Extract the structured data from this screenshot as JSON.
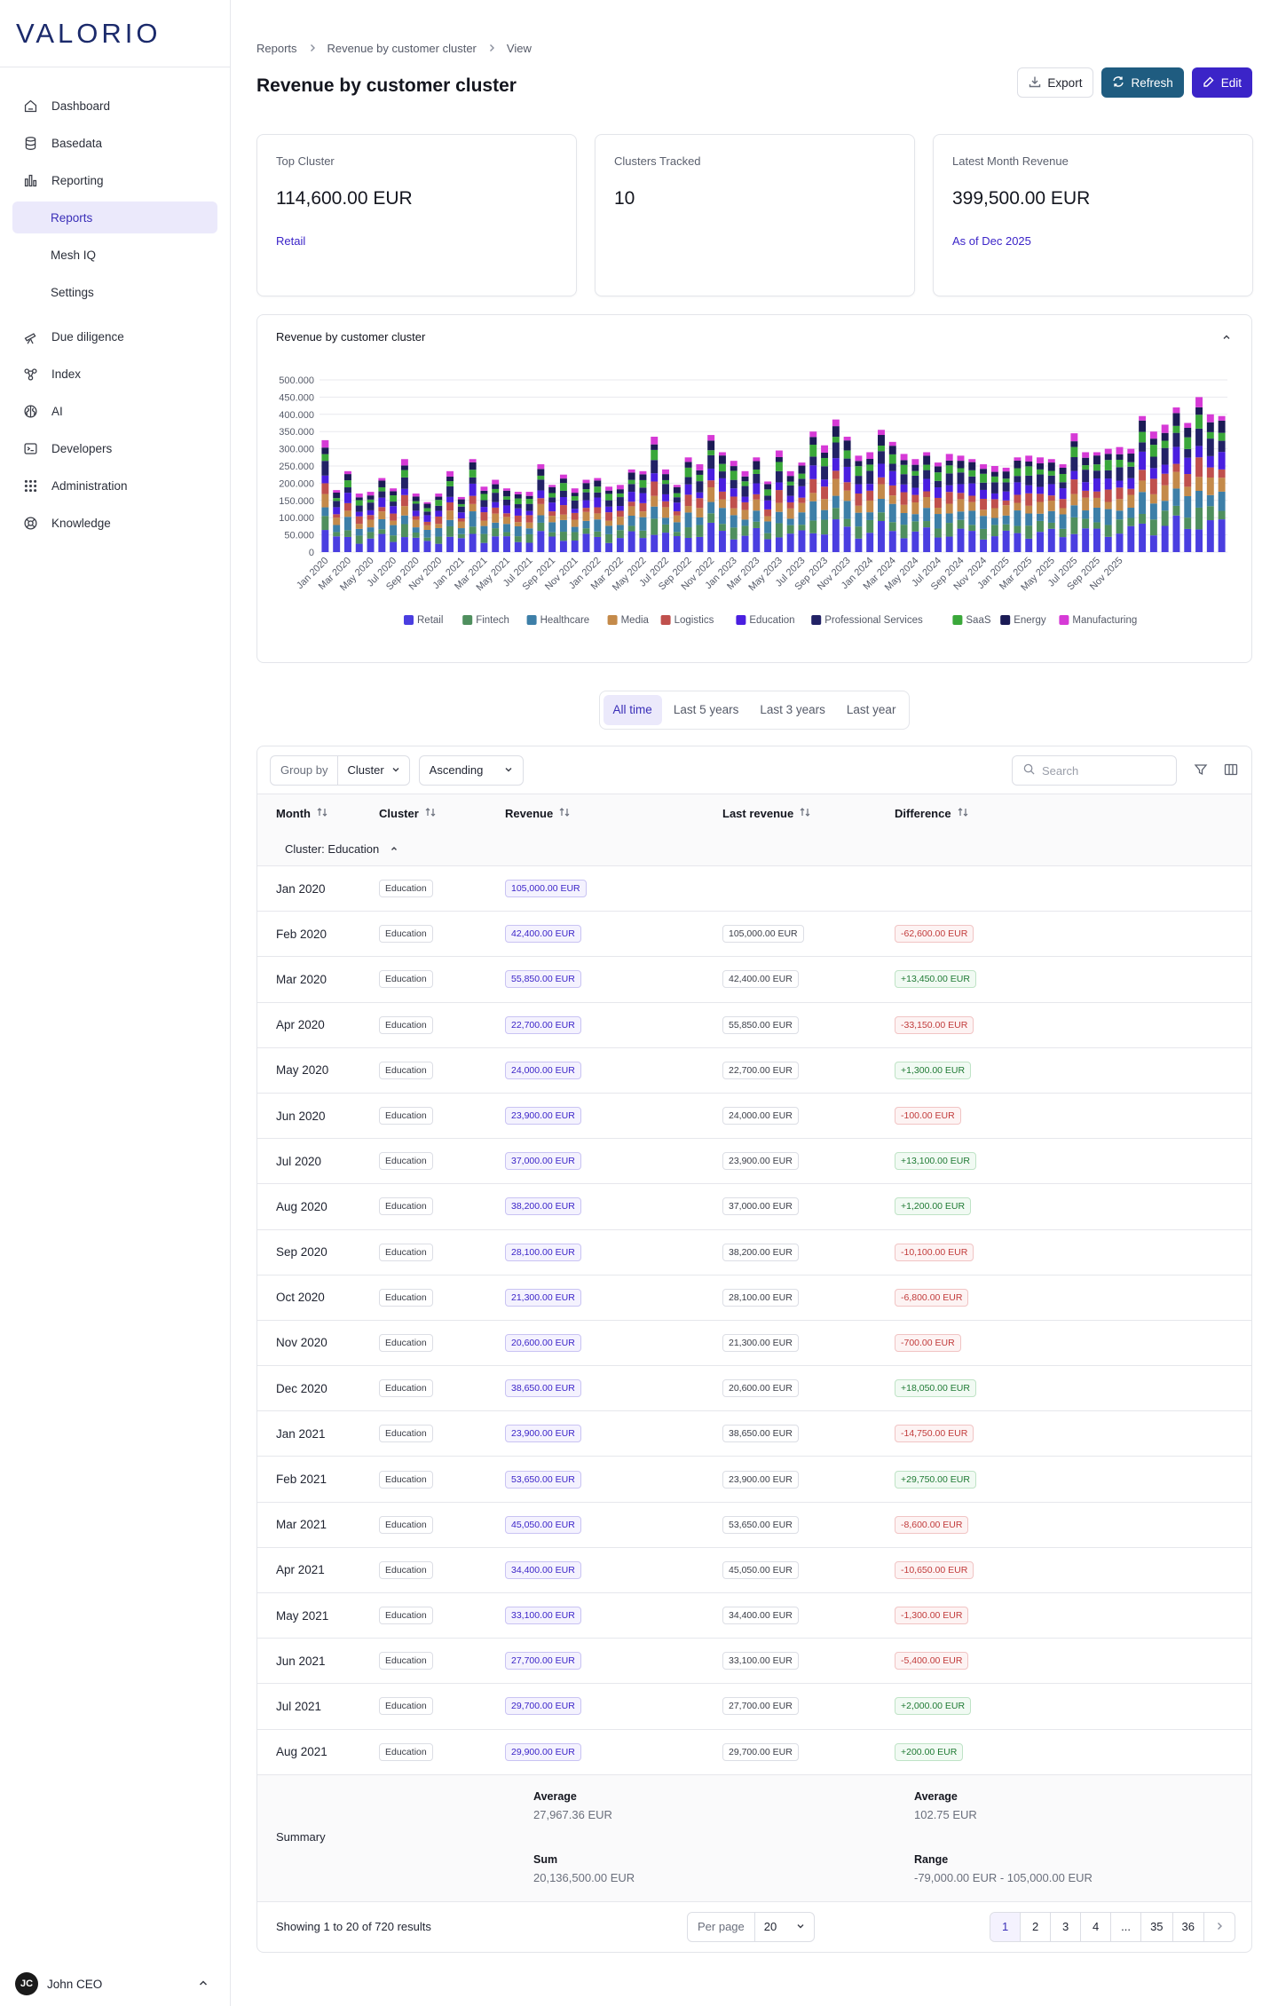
{
  "brand": "VALORIO",
  "nav": {
    "items": [
      {
        "label": "Dashboard",
        "icon": "home-icon"
      },
      {
        "label": "Basedata",
        "icon": "database-icon"
      },
      {
        "label": "Reporting",
        "icon": "bar-chart-icon"
      },
      {
        "label": "Reports",
        "icon": ""
      },
      {
        "label": "Mesh IQ",
        "icon": ""
      },
      {
        "label": "Settings",
        "icon": ""
      },
      {
        "label": "Due diligence",
        "icon": "telescope-icon"
      },
      {
        "label": "Index",
        "icon": "network-icon"
      },
      {
        "label": "AI",
        "icon": "brain-icon"
      },
      {
        "label": "Developers",
        "icon": "terminal-icon"
      },
      {
        "label": "Administration",
        "icon": "grid-icon"
      },
      {
        "label": "Knowledge",
        "icon": "lifebuoy-icon"
      }
    ]
  },
  "user": {
    "initials": "JC",
    "name": "John CEO"
  },
  "breadcrumb": [
    "Reports",
    "Revenue by customer cluster",
    "View"
  ],
  "page_title": "Revenue by customer cluster",
  "actions": {
    "export": "Export",
    "refresh": "Refresh",
    "edit": "Edit"
  },
  "cards": [
    {
      "label": "Top Cluster",
      "value": "114,600.00 EUR",
      "sub": "Retail"
    },
    {
      "label": "Clusters Tracked",
      "value": "10",
      "sub": ""
    },
    {
      "label": "Latest Month Revenue",
      "value": "399,500.00 EUR",
      "sub": "As of Dec 2025"
    }
  ],
  "chart_panel_title": "Revenue by customer cluster",
  "chart_data": {
    "type": "bar",
    "stacked": true,
    "ylim": [
      0,
      500000
    ],
    "yticks": [
      "0",
      "50.000",
      "100.000",
      "150.000",
      "200.000",
      "250.000",
      "300.000",
      "350.000",
      "400.000",
      "450.000",
      "500.000"
    ],
    "xtick_labels": [
      "Jan 2020",
      "Mar 2020",
      "May 2020",
      "Jul 2020",
      "Sep 2020",
      "Nov 2020",
      "Jan 2021",
      "Mar 2021",
      "May 2021",
      "Jul 2021",
      "Sep 2021",
      "Nov 2021",
      "Jan 2022",
      "Mar 2022",
      "May 2022",
      "Jul 2022",
      "Sep 2022",
      "Nov 2022",
      "Jan 2023",
      "Mar 2023",
      "May 2023",
      "Jul 2023",
      "Sep 2023",
      "Nov 2023",
      "Jan 2024",
      "Mar 2024",
      "May 2024",
      "Jul 2024",
      "Sep 2024",
      "Nov 2024",
      "Jan 2025",
      "Mar 2025",
      "May 2025",
      "Jul 2025",
      "Sep 2025",
      "Nov 2025"
    ],
    "totals": [
      325000,
      180000,
      235000,
      170000,
      175000,
      215000,
      185000,
      270000,
      170000,
      145000,
      170000,
      235000,
      160000,
      270000,
      190000,
      210000,
      185000,
      175000,
      175000,
      255000,
      195000,
      225000,
      185000,
      210000,
      215000,
      190000,
      195000,
      240000,
      235000,
      335000,
      240000,
      195000,
      275000,
      255000,
      340000,
      290000,
      265000,
      235000,
      275000,
      205000,
      295000,
      235000,
      260000,
      350000,
      310000,
      385000,
      335000,
      280000,
      290000,
      355000,
      320000,
      285000,
      270000,
      290000,
      260000,
      285000,
      280000,
      270000,
      255000,
      250000,
      245000,
      275000,
      280000,
      275000,
      270000,
      255000,
      345000,
      290000,
      290000,
      300000,
      305000,
      300000,
      395000,
      350000,
      370000,
      420000,
      375000,
      450000,
      400000,
      395000
    ],
    "series": [
      {
        "name": "Retail",
        "color": "#4a3ee0",
        "share": 0.2
      },
      {
        "name": "Fintech",
        "color": "#4f8f5e",
        "share": 0.1
      },
      {
        "name": "Healthcare",
        "color": "#3d7fa8",
        "share": 0.12
      },
      {
        "name": "Media",
        "color": "#c48a4a",
        "share": 0.1
      },
      {
        "name": "Logistics",
        "color": "#c0504d",
        "share": 0.09
      },
      {
        "name": "Education",
        "color": "#4a1fe0",
        "share": 0.1
      },
      {
        "name": "Professional Services",
        "color": "#222266",
        "share": 0.1
      },
      {
        "name": "SaaS",
        "color": "#3aa83a",
        "share": 0.07
      },
      {
        "name": "Energy",
        "color": "#1b1b55",
        "share": 0.07
      },
      {
        "name": "Manufacturing",
        "color": "#d63ad6",
        "share": 0.05
      }
    ]
  },
  "range_tabs": [
    "All time",
    "Last 5 years",
    "Last 3 years",
    "Last year"
  ],
  "toolbar": {
    "group_by_label": "Group by",
    "group_by_value": "Cluster",
    "sort_value": "Ascending",
    "search_placeholder": "Search"
  },
  "table": {
    "columns": [
      "Month",
      "Cluster",
      "Revenue",
      "Last revenue",
      "Difference"
    ],
    "group_label": "Cluster: Education",
    "rows": [
      {
        "month": "Jan 2020",
        "cluster": "Education",
        "revenue": "105,000.00 EUR",
        "last": "",
        "diff": "",
        "sign": ""
      },
      {
        "month": "Feb 2020",
        "cluster": "Education",
        "revenue": "42,400.00 EUR",
        "last": "105,000.00 EUR",
        "diff": "-62,600.00 EUR",
        "sign": "neg"
      },
      {
        "month": "Mar 2020",
        "cluster": "Education",
        "revenue": "55,850.00 EUR",
        "last": "42,400.00 EUR",
        "diff": "+13,450.00 EUR",
        "sign": "pos"
      },
      {
        "month": "Apr 2020",
        "cluster": "Education",
        "revenue": "22,700.00 EUR",
        "last": "55,850.00 EUR",
        "diff": "-33,150.00 EUR",
        "sign": "neg"
      },
      {
        "month": "May 2020",
        "cluster": "Education",
        "revenue": "24,000.00 EUR",
        "last": "22,700.00 EUR",
        "diff": "+1,300.00 EUR",
        "sign": "pos"
      },
      {
        "month": "Jun 2020",
        "cluster": "Education",
        "revenue": "23,900.00 EUR",
        "last": "24,000.00 EUR",
        "diff": "-100.00 EUR",
        "sign": "neg"
      },
      {
        "month": "Jul 2020",
        "cluster": "Education",
        "revenue": "37,000.00 EUR",
        "last": "23,900.00 EUR",
        "diff": "+13,100.00 EUR",
        "sign": "pos"
      },
      {
        "month": "Aug 2020",
        "cluster": "Education",
        "revenue": "38,200.00 EUR",
        "last": "37,000.00 EUR",
        "diff": "+1,200.00 EUR",
        "sign": "pos"
      },
      {
        "month": "Sep 2020",
        "cluster": "Education",
        "revenue": "28,100.00 EUR",
        "last": "38,200.00 EUR",
        "diff": "-10,100.00 EUR",
        "sign": "neg"
      },
      {
        "month": "Oct 2020",
        "cluster": "Education",
        "revenue": "21,300.00 EUR",
        "last": "28,100.00 EUR",
        "diff": "-6,800.00 EUR",
        "sign": "neg"
      },
      {
        "month": "Nov 2020",
        "cluster": "Education",
        "revenue": "20,600.00 EUR",
        "last": "21,300.00 EUR",
        "diff": "-700.00 EUR",
        "sign": "neg"
      },
      {
        "month": "Dec 2020",
        "cluster": "Education",
        "revenue": "38,650.00 EUR",
        "last": "20,600.00 EUR",
        "diff": "+18,050.00 EUR",
        "sign": "pos"
      },
      {
        "month": "Jan 2021",
        "cluster": "Education",
        "revenue": "23,900.00 EUR",
        "last": "38,650.00 EUR",
        "diff": "-14,750.00 EUR",
        "sign": "neg"
      },
      {
        "month": "Feb 2021",
        "cluster": "Education",
        "revenue": "53,650.00 EUR",
        "last": "23,900.00 EUR",
        "diff": "+29,750.00 EUR",
        "sign": "pos"
      },
      {
        "month": "Mar 2021",
        "cluster": "Education",
        "revenue": "45,050.00 EUR",
        "last": "53,650.00 EUR",
        "diff": "-8,600.00 EUR",
        "sign": "neg"
      },
      {
        "month": "Apr 2021",
        "cluster": "Education",
        "revenue": "34,400.00 EUR",
        "last": "45,050.00 EUR",
        "diff": "-10,650.00 EUR",
        "sign": "neg"
      },
      {
        "month": "May 2021",
        "cluster": "Education",
        "revenue": "33,100.00 EUR",
        "last": "34,400.00 EUR",
        "diff": "-1,300.00 EUR",
        "sign": "neg"
      },
      {
        "month": "Jun 2021",
        "cluster": "Education",
        "revenue": "27,700.00 EUR",
        "last": "33,100.00 EUR",
        "diff": "-5,400.00 EUR",
        "sign": "neg"
      },
      {
        "month": "Jul 2021",
        "cluster": "Education",
        "revenue": "29,700.00 EUR",
        "last": "27,700.00 EUR",
        "diff": "+2,000.00 EUR",
        "sign": "pos"
      },
      {
        "month": "Aug 2021",
        "cluster": "Education",
        "revenue": "29,900.00 EUR",
        "last": "29,700.00 EUR",
        "diff": "+200.00 EUR",
        "sign": "pos"
      }
    ]
  },
  "summary": {
    "label": "Summary",
    "avg_rev_label": "Average",
    "avg_rev": "27,967.36 EUR",
    "sum_label": "Sum",
    "sum": "20,136,500.00 EUR",
    "avg_diff_label": "Average",
    "avg_diff": "102.75 EUR",
    "range_label": "Range",
    "range": "-79,000.00 EUR - 105,000.00 EUR"
  },
  "footer": {
    "showing": "Showing 1 to 20 of 720 results",
    "per_page_label": "Per page",
    "per_page": "20",
    "pages": [
      "1",
      "2",
      "3",
      "4",
      "...",
      "35",
      "36"
    ]
  }
}
